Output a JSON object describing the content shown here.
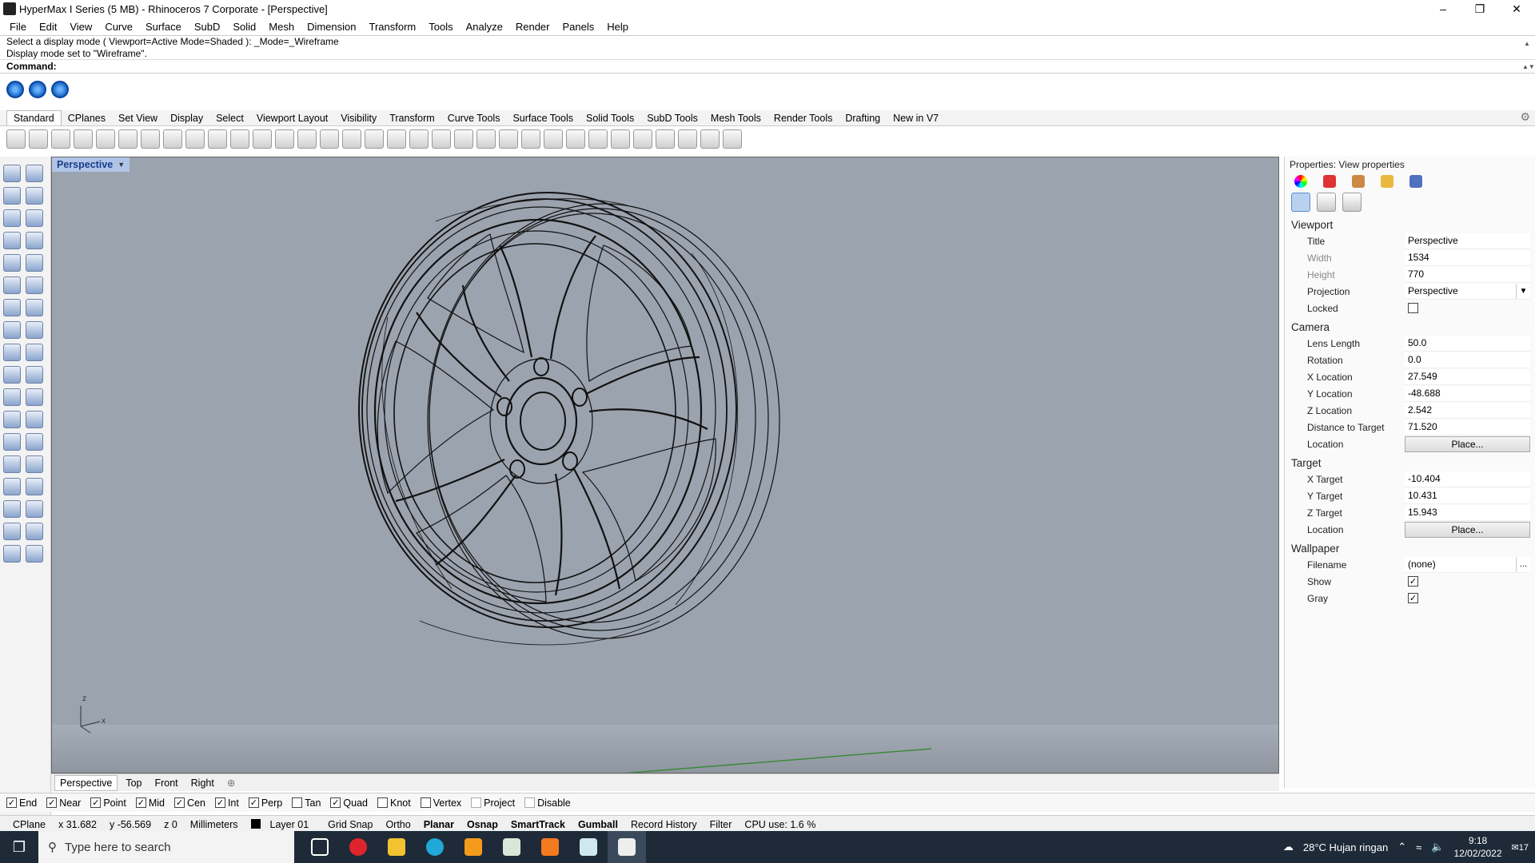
{
  "window": {
    "title": "HyperMax I Series (5 MB) - Rhinoceros 7 Corporate - [Perspective]"
  },
  "menu": [
    "File",
    "Edit",
    "View",
    "Curve",
    "Surface",
    "SubD",
    "Solid",
    "Mesh",
    "Dimension",
    "Transform",
    "Tools",
    "Analyze",
    "Render",
    "Panels",
    "Help"
  ],
  "command": {
    "history_line1": "Select a display mode ( Viewport=Active  Mode=Shaded ): _Mode=_Wireframe",
    "history_line2": "Display mode set to \"Wireframe\".",
    "prompt": "Command:"
  },
  "toolbar_tabs": [
    "Standard",
    "CPlanes",
    "Set View",
    "Display",
    "Select",
    "Viewport Layout",
    "Visibility",
    "Transform",
    "Curve Tools",
    "Surface Tools",
    "Solid Tools",
    "SubD Tools",
    "Mesh Tools",
    "Render Tools",
    "Drafting",
    "New in V7"
  ],
  "viewport": {
    "label": "Perspective",
    "axis_z": "z",
    "axis_x": "x"
  },
  "view_tabs": [
    "Perspective",
    "Top",
    "Front",
    "Right"
  ],
  "osnaps": [
    {
      "label": "End",
      "checked": true
    },
    {
      "label": "Near",
      "checked": true
    },
    {
      "label": "Point",
      "checked": true
    },
    {
      "label": "Mid",
      "checked": true
    },
    {
      "label": "Cen",
      "checked": true
    },
    {
      "label": "Int",
      "checked": true
    },
    {
      "label": "Perp",
      "checked": true
    },
    {
      "label": "Tan",
      "checked": false
    },
    {
      "label": "Quad",
      "checked": true
    },
    {
      "label": "Knot",
      "checked": false
    },
    {
      "label": "Vertex",
      "checked": false
    },
    {
      "label": "Project",
      "checked": false
    },
    {
      "label": "Disable",
      "checked": false
    }
  ],
  "status": {
    "cplane": "CPlane",
    "x": "x 31.682",
    "y": "y -56.569",
    "z": "z 0",
    "units": "Millimeters",
    "layer": "Layer 01",
    "grid_snap": "Grid Snap",
    "ortho": "Ortho",
    "planar": "Planar",
    "osnap": "Osnap",
    "smarttrack": "SmartTrack",
    "gumball": "Gumball",
    "record_history": "Record History",
    "filter": "Filter",
    "cpu": "CPU use: 1.6 %"
  },
  "properties": {
    "header": "Properties: View properties",
    "viewport_section": "Viewport",
    "title_k": "Title",
    "title_v": "Perspective",
    "width_k": "Width",
    "width_v": "1534",
    "height_k": "Height",
    "height_v": "770",
    "projection_k": "Projection",
    "projection_v": "Perspective",
    "locked_k": "Locked",
    "camera_section": "Camera",
    "lens_k": "Lens Length",
    "lens_v": "50.0",
    "rotation_k": "Rotation",
    "rotation_v": "0.0",
    "xloc_k": "X Location",
    "xloc_v": "27.549",
    "yloc_k": "Y Location",
    "yloc_v": "-48.688",
    "zloc_k": "Z Location",
    "zloc_v": "2.542",
    "dist_k": "Distance to Target",
    "dist_v": "71.520",
    "location_k": "Location",
    "place_label": "Place...",
    "target_section": "Target",
    "xt_k": "X Target",
    "xt_v": "-10.404",
    "yt_k": "Y Target",
    "yt_v": "10.431",
    "zt_k": "Z Target",
    "zt_v": "15.943",
    "tloc_k": "Location",
    "wallpaper_section": "Wallpaper",
    "filename_k": "Filename",
    "filename_v": "(none)",
    "browse": "...",
    "show_k": "Show",
    "gray_k": "Gray"
  },
  "taskbar": {
    "search_placeholder": "Type here to search",
    "weather": "28°C  Hujan ringan",
    "time": "9:18",
    "date": "12/02/2022",
    "notif_count": "17"
  },
  "colors": {
    "viewport_bg": "#9ba3ae",
    "active_viewport_label": "#b0c4e8",
    "taskbar": "#1e2a38"
  }
}
